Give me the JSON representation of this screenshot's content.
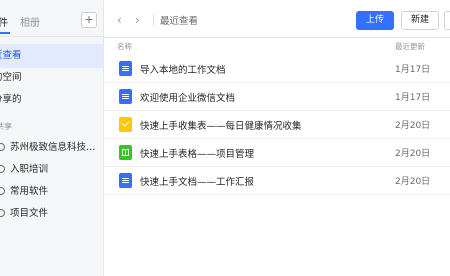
{
  "sidebar": {
    "tabs": {
      "files": "件",
      "albums": "相册"
    },
    "add_button": "+",
    "nav": [
      {
        "label": "近查看",
        "active": true
      },
      {
        "label": "的空间",
        "active": false
      },
      {
        "label": "分享的",
        "active": false
      }
    ],
    "section_label": "共享",
    "folders": [
      {
        "label": "苏州极致信息科技有..."
      },
      {
        "label": "入职培训"
      },
      {
        "label": "常用软件"
      },
      {
        "label": "项目文件"
      }
    ]
  },
  "header": {
    "back_arrow": "‹",
    "forward_arrow": "›",
    "breadcrumb": "最近查看",
    "upload_label": "上传",
    "new_label": "新建"
  },
  "columns": {
    "name": "名称",
    "modified": "最近更新"
  },
  "files": [
    {
      "name": "导入本地的工作文档",
      "date": "1月17日",
      "icon": "doc-icon"
    },
    {
      "name": "欢迎使用企业微信文档",
      "date": "1月17日",
      "icon": "doc-icon"
    },
    {
      "name": "快速上手收集表——每日健康情况收集",
      "date": "2月20日",
      "icon": "form-icon"
    },
    {
      "name": "快速上手表格——项目管理",
      "date": "2月20日",
      "icon": "sheet-icon"
    },
    {
      "name": "快速上手文档——工作汇报",
      "date": "2月20日",
      "icon": "doc-icon"
    }
  ],
  "colors": {
    "accent": "#3370ff",
    "doc": "#3370ff",
    "form": "#ffc60a",
    "sheet": "#34c724"
  }
}
